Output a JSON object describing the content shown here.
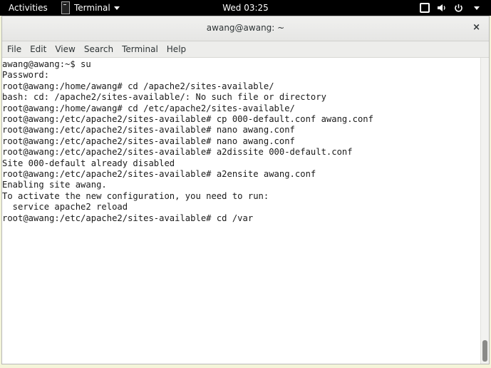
{
  "topbar": {
    "activities": "Activities",
    "app_name": "Terminal",
    "clock": "Wed 03:25"
  },
  "window": {
    "title": "awang@awang: ~",
    "close_glyph": "×"
  },
  "menu": {
    "file": "File",
    "edit": "Edit",
    "view": "View",
    "search": "Search",
    "terminal": "Terminal",
    "help": "Help"
  },
  "terminal": {
    "lines": [
      "awang@awang:~$ su",
      "Password:",
      "root@awang:/home/awang# cd /apache2/sites-available/",
      "bash: cd: /apache2/sites-available/: No such file or directory",
      "root@awang:/home/awang# cd /etc/apache2/sites-available/",
      "root@awang:/etc/apache2/sites-available# cp 000-default.conf awang.conf",
      "root@awang:/etc/apache2/sites-available# nano awang.conf",
      "root@awang:/etc/apache2/sites-available# nano awang.conf",
      "root@awang:/etc/apache2/sites-available# a2dissite 000-default.conf",
      "Site 000-default already disabled",
      "root@awang:/etc/apache2/sites-available# a2ensite awang.conf",
      "Enabling site awang.",
      "To activate the new configuration, you need to run:",
      "  service apache2 reload",
      "root@awang:/etc/apache2/sites-available# cd /var"
    ]
  },
  "icons": {
    "app": "terminal-app-icon",
    "windows": "window-overview-icon",
    "volume": "volume-icon",
    "power": "power-icon"
  }
}
